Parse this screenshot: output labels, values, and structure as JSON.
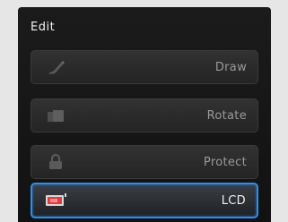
{
  "menu": {
    "title": "Edit",
    "items": [
      {
        "label": "Draw",
        "icon": "pen-icon"
      },
      {
        "label": "Rotate",
        "icon": "rotate-icon"
      },
      {
        "label": "Protect",
        "icon": "lock-icon"
      },
      {
        "label": "LCD",
        "icon": "lcd-icon",
        "selected": true
      }
    ]
  },
  "colors": {
    "panel": "#161616",
    "selected_border": "#2f8fe6",
    "lcd_accent": "#e23b3b"
  }
}
